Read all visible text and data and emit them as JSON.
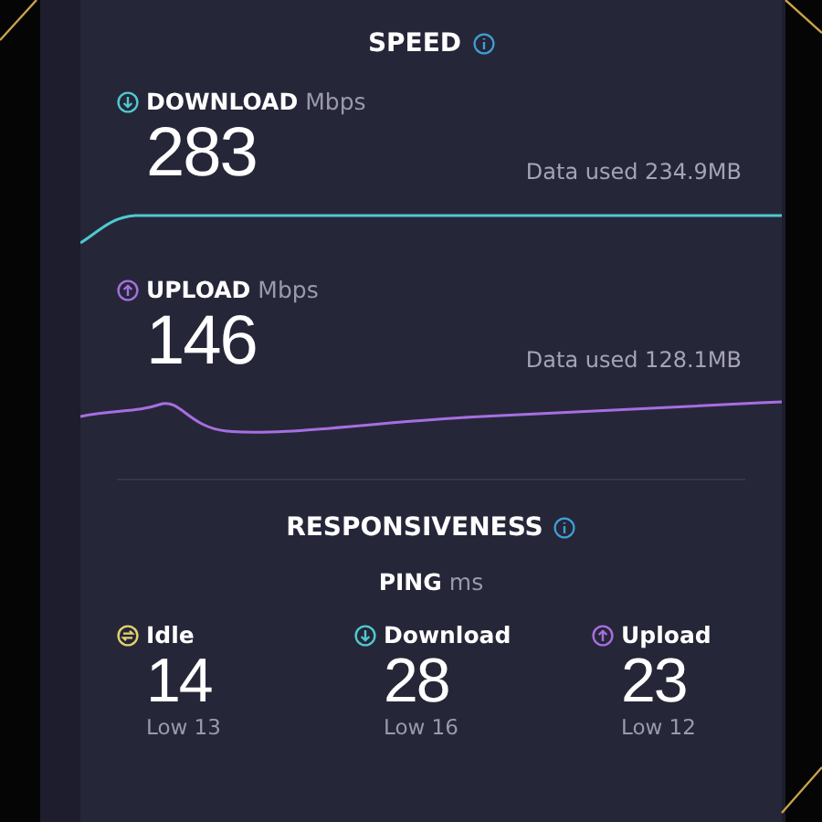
{
  "speed": {
    "title": "SPEED",
    "metrics": [
      {
        "kind": "download",
        "label": "DOWNLOAD",
        "unit": "Mbps",
        "value": "283",
        "data_used": "Data used 234.9MB"
      },
      {
        "kind": "upload",
        "label": "UPLOAD",
        "unit": "Mbps",
        "value": "146",
        "data_used": "Data used 128.1MB"
      }
    ]
  },
  "responsiveness": {
    "title": "RESPONSIVENESS",
    "ping_label": "PING",
    "ping_unit": "ms",
    "pings": [
      {
        "kind": "idle",
        "label": "Idle",
        "value": "14",
        "low": "Low 13"
      },
      {
        "kind": "download",
        "label": "Download",
        "value": "28",
        "low": "Low 16"
      },
      {
        "kind": "upload",
        "label": "Upload",
        "value": "23",
        "low": "Low 12"
      }
    ]
  }
}
